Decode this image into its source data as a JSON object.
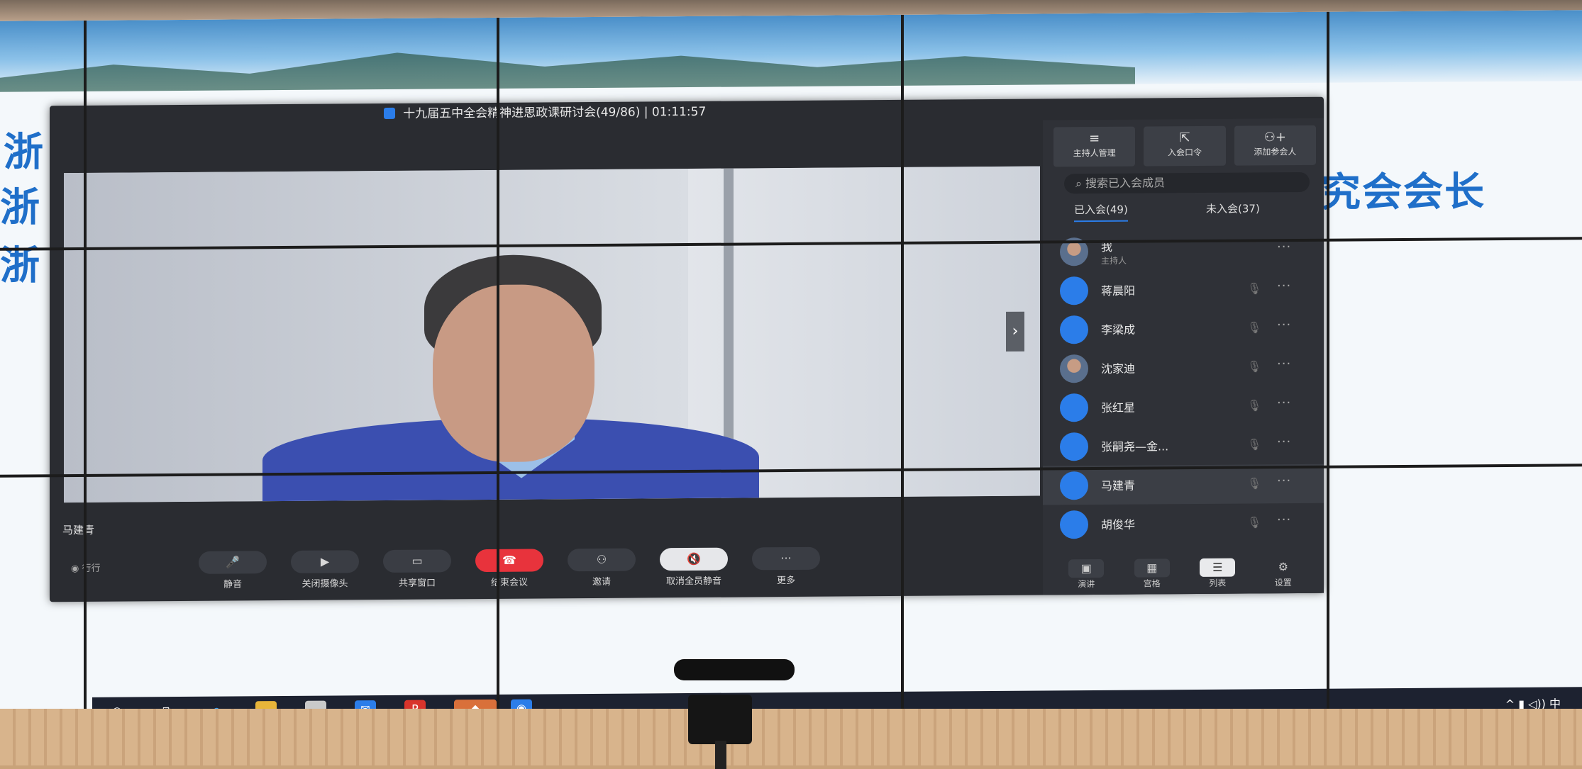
{
  "slide": {
    "lines": [
      "浙",
      "浙",
      "浙"
    ],
    "right_text": "究会会长"
  },
  "meeting": {
    "title": "十九届五中全会精神进思政课研讨会(49/86)",
    "timer": "01:11:57",
    "speaker_name": "马建青",
    "network_label": "行行"
  },
  "panel": {
    "buttons": [
      {
        "icon": "≡",
        "label": "主持人管理"
      },
      {
        "icon": "⇱",
        "label": "入会口令"
      },
      {
        "icon": "⚇+",
        "label": "添加参会人"
      }
    ],
    "search_placeholder": "搜索已入会成员",
    "tabs": [
      {
        "label": "已入会(49)",
        "active": true
      },
      {
        "label": "未入会(37)",
        "active": false
      }
    ],
    "participants": [
      {
        "name": "我",
        "role": "主持人",
        "avatar": "photo"
      },
      {
        "name": "蒋晨阳",
        "avatar": "blue"
      },
      {
        "name": "李梁成",
        "avatar": "blue"
      },
      {
        "name": "沈家迪",
        "avatar": "photo"
      },
      {
        "name": "张红星",
        "avatar": "blue"
      },
      {
        "name": "张嗣尧—金...",
        "avatar": "blue"
      },
      {
        "name": "马建青",
        "avatar": "blue",
        "highlight": true
      },
      {
        "name": "胡俊华",
        "avatar": "blue"
      }
    ],
    "views": [
      {
        "label": "演讲",
        "icon": "▣",
        "active": false
      },
      {
        "label": "宫格",
        "icon": "▦",
        "active": false
      },
      {
        "label": "列表",
        "icon": "☰",
        "active": true
      },
      {
        "label": "设置",
        "icon": "⚙",
        "active": false
      }
    ]
  },
  "toolbar": [
    {
      "label": "静音",
      "icon": "🎤"
    },
    {
      "label": "关闭摄像头",
      "icon": "▶"
    },
    {
      "label": "共享窗口",
      "icon": "▭"
    },
    {
      "label": "结束会议",
      "icon": "☎"
    },
    {
      "label": "邀请",
      "icon": "⚇"
    },
    {
      "label": "取消全员静音",
      "icon": "🔇"
    },
    {
      "label": "更多",
      "icon": "···"
    }
  ],
  "taskbar": {
    "tray_text": "^ ▮ ◁)) 中"
  }
}
